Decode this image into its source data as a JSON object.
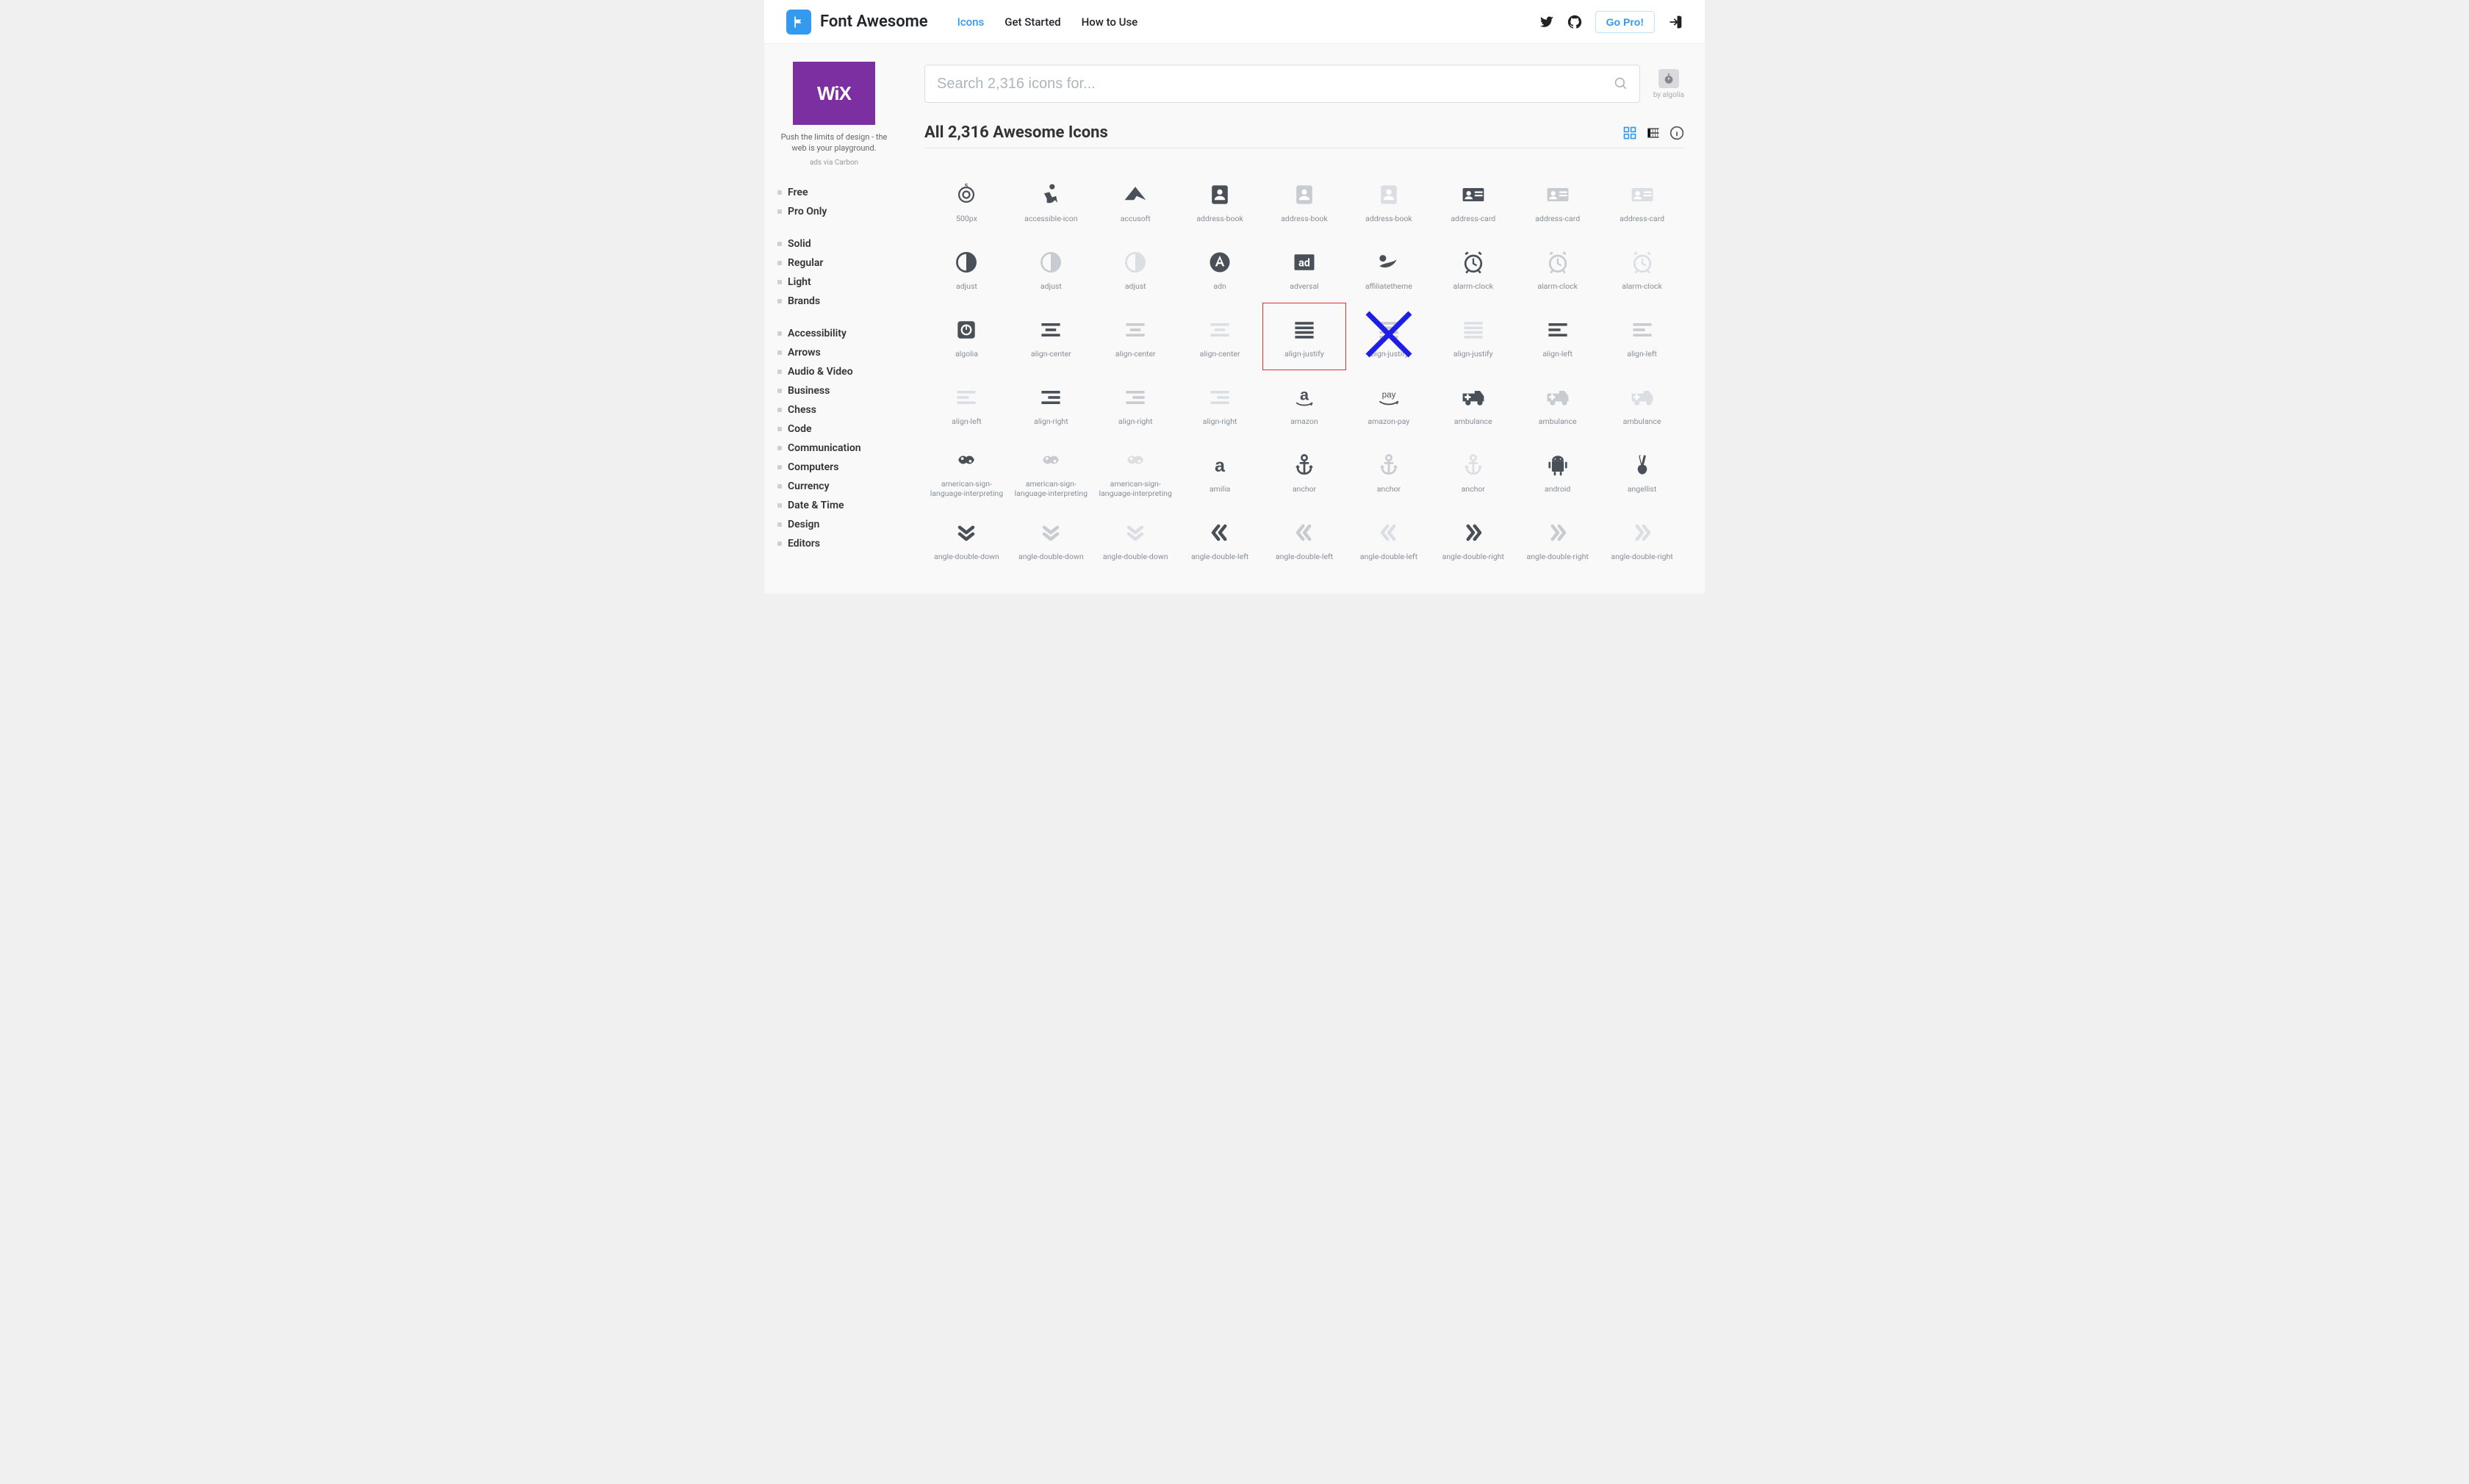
{
  "header": {
    "brand": "Font Awesome",
    "nav": [
      {
        "label": "Icons",
        "active": true
      },
      {
        "label": "Get Started",
        "active": false
      },
      {
        "label": "How to Use",
        "active": false
      }
    ],
    "go_pro": "Go Pro!"
  },
  "sidebar": {
    "ad": {
      "brand": "WiX",
      "text": "Push the limits of design - the web is your playground.",
      "by": "ads via Carbon"
    },
    "groups": [
      {
        "items": [
          "Free",
          "Pro Only"
        ]
      },
      {
        "items": [
          "Solid",
          "Regular",
          "Light",
          "Brands"
        ]
      },
      {
        "items": [
          "Accessibility",
          "Arrows",
          "Audio & Video",
          "Business",
          "Chess",
          "Code",
          "Communication",
          "Computers",
          "Currency",
          "Date & Time",
          "Design",
          "Editors"
        ]
      }
    ]
  },
  "search": {
    "placeholder": "Search 2,316 icons for...",
    "algolia_by": "by algolia"
  },
  "main_heading": "All 2,316 Awesome Icons",
  "icons": [
    {
      "name": "500px",
      "style": "brands",
      "svg": "500px"
    },
    {
      "name": "accessible-icon",
      "style": "brands",
      "svg": "accessible"
    },
    {
      "name": "accusoft",
      "style": "brands",
      "svg": "accusoft"
    },
    {
      "name": "address-book",
      "style": "solid",
      "svg": "address-book"
    },
    {
      "name": "address-book",
      "style": "reg",
      "svg": "address-book"
    },
    {
      "name": "address-book",
      "style": "light",
      "svg": "address-book"
    },
    {
      "name": "address-card",
      "style": "solid",
      "svg": "address-card"
    },
    {
      "name": "address-card",
      "style": "reg",
      "svg": "address-card"
    },
    {
      "name": "address-card",
      "style": "light",
      "svg": "address-card"
    },
    {
      "name": "adjust",
      "style": "solid",
      "svg": "adjust"
    },
    {
      "name": "adjust",
      "style": "reg",
      "svg": "adjust"
    },
    {
      "name": "adjust",
      "style": "light",
      "svg": "adjust"
    },
    {
      "name": "adn",
      "style": "brands",
      "svg": "adn"
    },
    {
      "name": "adversal",
      "style": "brands",
      "svg": "adversal"
    },
    {
      "name": "affiliatetheme",
      "style": "brands",
      "svg": "affiliatetheme"
    },
    {
      "name": "alarm-clock",
      "style": "solid",
      "svg": "alarm-clock"
    },
    {
      "name": "alarm-clock",
      "style": "reg",
      "svg": "alarm-clock"
    },
    {
      "name": "alarm-clock",
      "style": "light",
      "svg": "alarm-clock"
    },
    {
      "name": "algolia",
      "style": "brands",
      "svg": "algolia"
    },
    {
      "name": "align-center",
      "style": "solid",
      "svg": "align-center"
    },
    {
      "name": "align-center",
      "style": "reg",
      "svg": "align-center"
    },
    {
      "name": "align-center",
      "style": "light",
      "svg": "align-center"
    },
    {
      "name": "align-justify",
      "style": "solid",
      "svg": "align-justify",
      "highlight": "red"
    },
    {
      "name": "align-justify",
      "style": "reg",
      "svg": "align-justify",
      "highlight": "blue-x"
    },
    {
      "name": "align-justify",
      "style": "light",
      "svg": "align-justify"
    },
    {
      "name": "align-left",
      "style": "solid",
      "svg": "align-left"
    },
    {
      "name": "align-left",
      "style": "reg",
      "svg": "align-left"
    },
    {
      "name": "align-left",
      "style": "light",
      "svg": "align-left"
    },
    {
      "name": "align-right",
      "style": "solid",
      "svg": "align-right"
    },
    {
      "name": "align-right",
      "style": "reg",
      "svg": "align-right"
    },
    {
      "name": "align-right",
      "style": "light",
      "svg": "align-right"
    },
    {
      "name": "amazon",
      "style": "brands",
      "svg": "amazon"
    },
    {
      "name": "amazon-pay",
      "style": "brands",
      "svg": "amazon-pay"
    },
    {
      "name": "ambulance",
      "style": "solid",
      "svg": "ambulance"
    },
    {
      "name": "ambulance",
      "style": "reg",
      "svg": "ambulance"
    },
    {
      "name": "ambulance",
      "style": "light",
      "svg": "ambulance"
    },
    {
      "name": "american-sign-language-interpreting",
      "style": "solid",
      "svg": "asl"
    },
    {
      "name": "american-sign-language-interpreting",
      "style": "reg",
      "svg": "asl"
    },
    {
      "name": "american-sign-language-interpreting",
      "style": "light",
      "svg": "asl"
    },
    {
      "name": "amilia",
      "style": "brands",
      "svg": "amilia"
    },
    {
      "name": "anchor",
      "style": "solid",
      "svg": "anchor"
    },
    {
      "name": "anchor",
      "style": "reg",
      "svg": "anchor"
    },
    {
      "name": "anchor",
      "style": "light",
      "svg": "anchor"
    },
    {
      "name": "android",
      "style": "brands",
      "svg": "android"
    },
    {
      "name": "angellist",
      "style": "brands",
      "svg": "angellist"
    },
    {
      "name": "angle-double-down",
      "style": "solid",
      "svg": "angle-dd"
    },
    {
      "name": "angle-double-down",
      "style": "reg",
      "svg": "angle-dd"
    },
    {
      "name": "angle-double-down",
      "style": "light",
      "svg": "angle-dd"
    },
    {
      "name": "angle-double-left",
      "style": "solid",
      "svg": "angle-dl"
    },
    {
      "name": "angle-double-left",
      "style": "reg",
      "svg": "angle-dl"
    },
    {
      "name": "angle-double-left",
      "style": "light",
      "svg": "angle-dl"
    },
    {
      "name": "angle-double-right",
      "style": "solid",
      "svg": "angle-dr"
    },
    {
      "name": "angle-double-right",
      "style": "reg",
      "svg": "angle-dr"
    },
    {
      "name": "angle-double-right",
      "style": "light",
      "svg": "angle-dr"
    }
  ]
}
